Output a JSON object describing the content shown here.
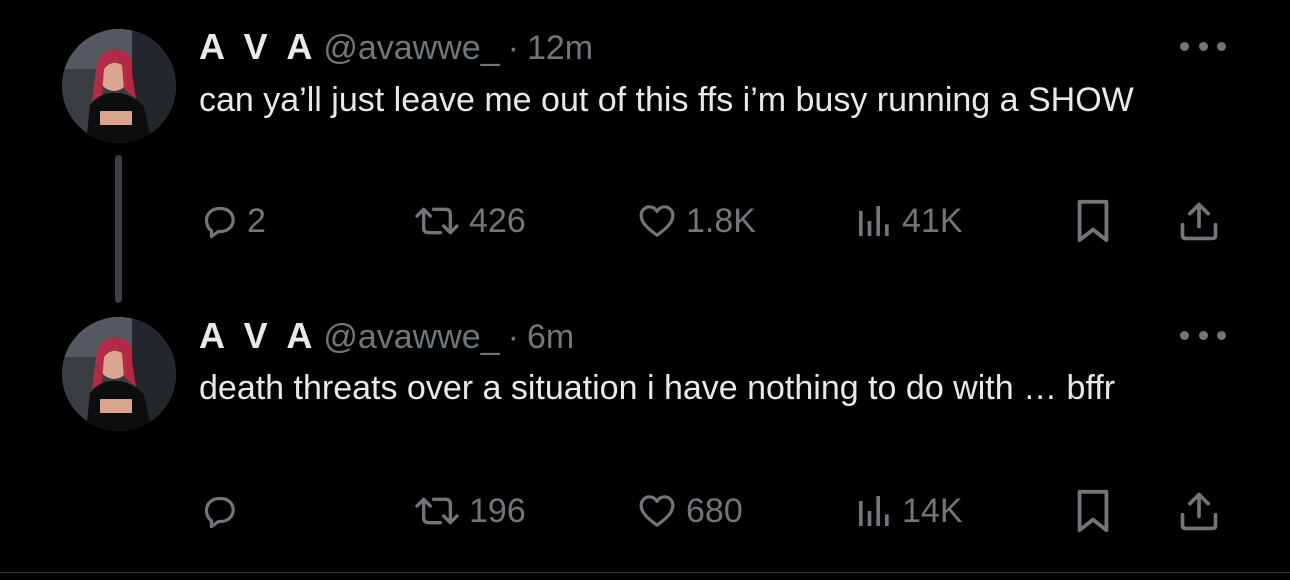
{
  "colors": {
    "background": "#000000",
    "text_primary": "#e7e9ea",
    "text_secondary": "#71767b",
    "thread_line": "#3b3f43",
    "divider": "#2f3336"
  },
  "tweets": [
    {
      "display_name": "A V A",
      "handle": "@avawwe_",
      "separator": "·",
      "time": "12m",
      "text": "can ya’ll just leave me out of this ffs i’m busy running a SHOW",
      "more_icon": "more-dots-icon",
      "stats": {
        "replies": "2",
        "retweets": "426",
        "likes": "1.8K",
        "views": "41K"
      }
    },
    {
      "display_name": "A V A",
      "handle": "@avawwe_",
      "separator": "·",
      "time": "6m",
      "text": "death threats over a situation i have nothing to do with … bffr",
      "more_icon": "more-dots-icon",
      "stats": {
        "replies": "",
        "retweets": "196",
        "likes": "680",
        "views": "14K"
      }
    }
  ],
  "icons": {
    "reply": "reply-bubble-icon",
    "retweet": "retweet-arrows-icon",
    "like": "heart-icon",
    "views": "views-bar-chart-icon",
    "bookmark": "bookmark-icon",
    "share": "share-upload-icon"
  }
}
